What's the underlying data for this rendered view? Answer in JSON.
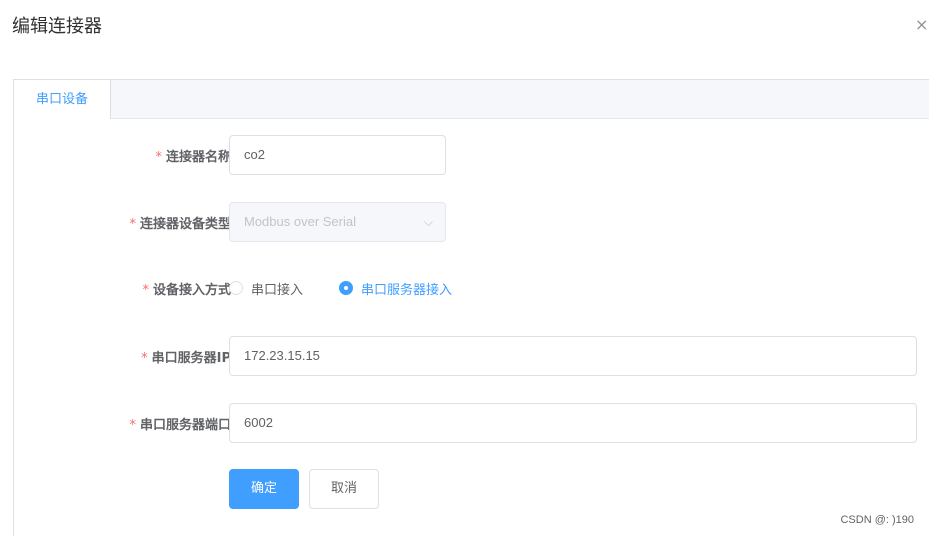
{
  "dialog": {
    "title": "编辑连接器",
    "close_glyph": "×"
  },
  "tabs": [
    {
      "label": "串口设备",
      "active": true
    }
  ],
  "form": {
    "required_mark": "*",
    "connector_name": {
      "label": "连接器名称",
      "value": "co2"
    },
    "device_type": {
      "label": "连接器设备类型",
      "value": "Modbus over Serial",
      "disabled": true,
      "arrow_glyph": "⌵"
    },
    "access_mode": {
      "label": "设备接入方式",
      "options": [
        {
          "label": "串口接入",
          "checked": false
        },
        {
          "label": "串口服务器接入",
          "checked": true
        }
      ]
    },
    "server_ip": {
      "label": "串口服务器IP",
      "value": "172.23.15.15"
    },
    "server_port": {
      "label": "串口服务器端口",
      "value": "6002"
    }
  },
  "actions": {
    "confirm_label": "确定",
    "cancel_label": "取消"
  },
  "watermark": "CSDN @: )190",
  "colors": {
    "primary": "#409eff",
    "required": "#f56c6c",
    "border": "#dcdfe6"
  }
}
